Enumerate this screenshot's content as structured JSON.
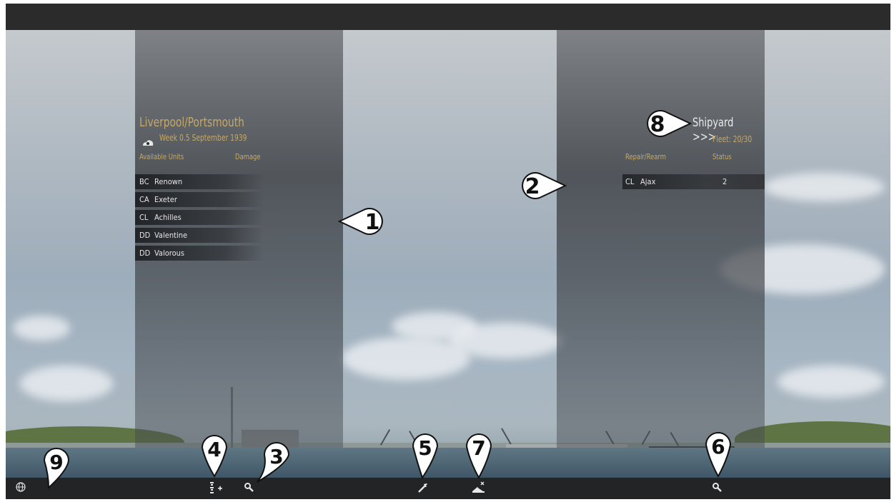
{
  "location": {
    "title": "Liverpool/Portsmouth",
    "date": "Week 0.5 September 1939",
    "weather_icon": "cloud-sun-icon"
  },
  "units_panel": {
    "col_units": "Available Units",
    "col_damage": "Damage",
    "units": [
      {
        "type": "BC",
        "name": "Renown"
      },
      {
        "type": "CA",
        "name": "Exeter"
      },
      {
        "type": "CL",
        "name": "Achilles"
      },
      {
        "type": "DD",
        "name": "Valentine"
      },
      {
        "type": "DD",
        "name": "Valorous"
      }
    ]
  },
  "shipyard_panel": {
    "title": "Shipyard >>>",
    "fleet": "Fleet: 20/30",
    "col_repair": "Repair/Rearm",
    "col_status": "Status",
    "items": [
      {
        "type": "CL",
        "name": "Ajax",
        "status": "2"
      }
    ]
  },
  "toolbar": {
    "globe_icon": "globe-icon",
    "add_unit_icon": "add-unit-icon",
    "search_icon": "search-icon",
    "repair_icon": "wrench-icon",
    "scuttle_icon": "scuttle-ship-icon"
  },
  "callouts": [
    "1",
    "2",
    "3",
    "4",
    "5",
    "6",
    "7",
    "8",
    "9"
  ],
  "colors": {
    "gold_text": "#c5a868",
    "panel": "#3c3f44",
    "bar": "#222426"
  }
}
